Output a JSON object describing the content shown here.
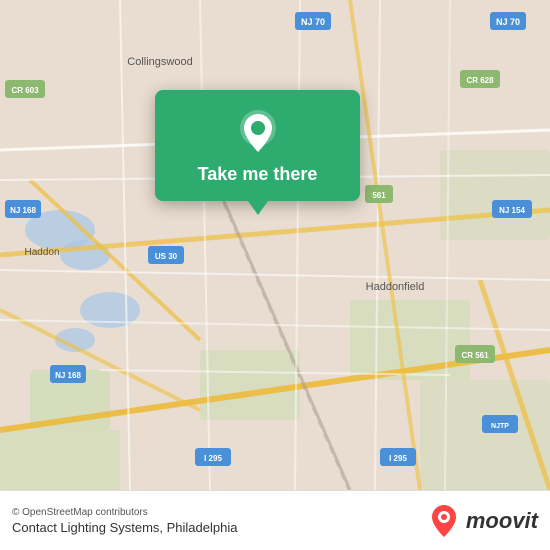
{
  "map": {
    "attribution": "© OpenStreetMap contributors",
    "background_color": "#e8e0d8"
  },
  "popup": {
    "button_label": "Take me there",
    "pin_icon": "location-pin-icon"
  },
  "bottom_bar": {
    "osm_credit": "© OpenStreetMap contributors",
    "location_label": "Contact Lighting Systems, Philadelphia",
    "moovit_text": "moovit"
  }
}
